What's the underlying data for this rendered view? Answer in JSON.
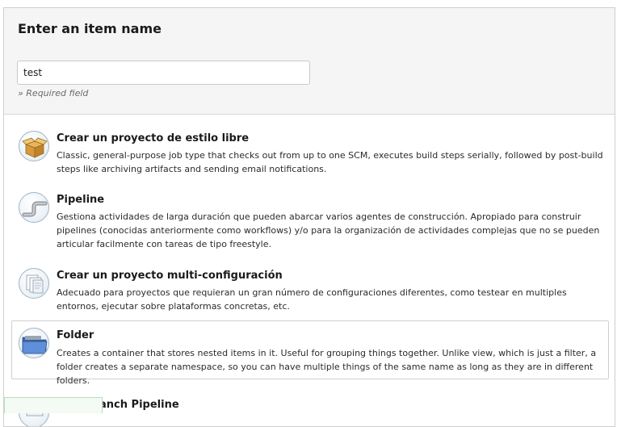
{
  "header": {
    "title": "Enter an item name",
    "input_value": "test",
    "required_hint": "» Required field"
  },
  "items": [
    {
      "title": "Crear un proyecto de estilo libre",
      "description": "Classic, general-purpose job type that checks out from up to one SCM, executes build steps serially, followed by post-build steps like archiving artifacts and sending email notifications.",
      "icon": "freestyle-box-icon"
    },
    {
      "title": "Pipeline",
      "description": "Gestiona actividades de larga duración que pueden abarcar varios agentes de construcción. Apropiado para construir pipelines (conocidas anteriormente como workflows) y/o para la organización de actividades complejas que no se pueden articular facilmente con tareas de tipo freestyle.",
      "icon": "pipeline-icon"
    },
    {
      "title": "Crear un proyecto multi-configuración",
      "description": "Adecuado para proyectos que requieran un gran número de configuraciones diferentes, como testear en multiples entornos, ejecutar sobre plataformas concretas, etc.",
      "icon": "multi-config-icon"
    },
    {
      "title": "Folder",
      "description": "Creates a container that stores nested items in it. Useful for grouping things together. Unlike view, which is just a filter, a folder creates a separate namespace, so you can have multiple things of the same name as long as they are in different folders.",
      "icon": "folder-icon",
      "selected": true
    },
    {
      "title": "Multibranch Pipeline",
      "description": "",
      "icon": "multibranch-icon"
    }
  ],
  "colors": {
    "header_bg": "#f5f5f6",
    "border": "#cfcfcf",
    "folder_blue": "#4a7bc8"
  }
}
